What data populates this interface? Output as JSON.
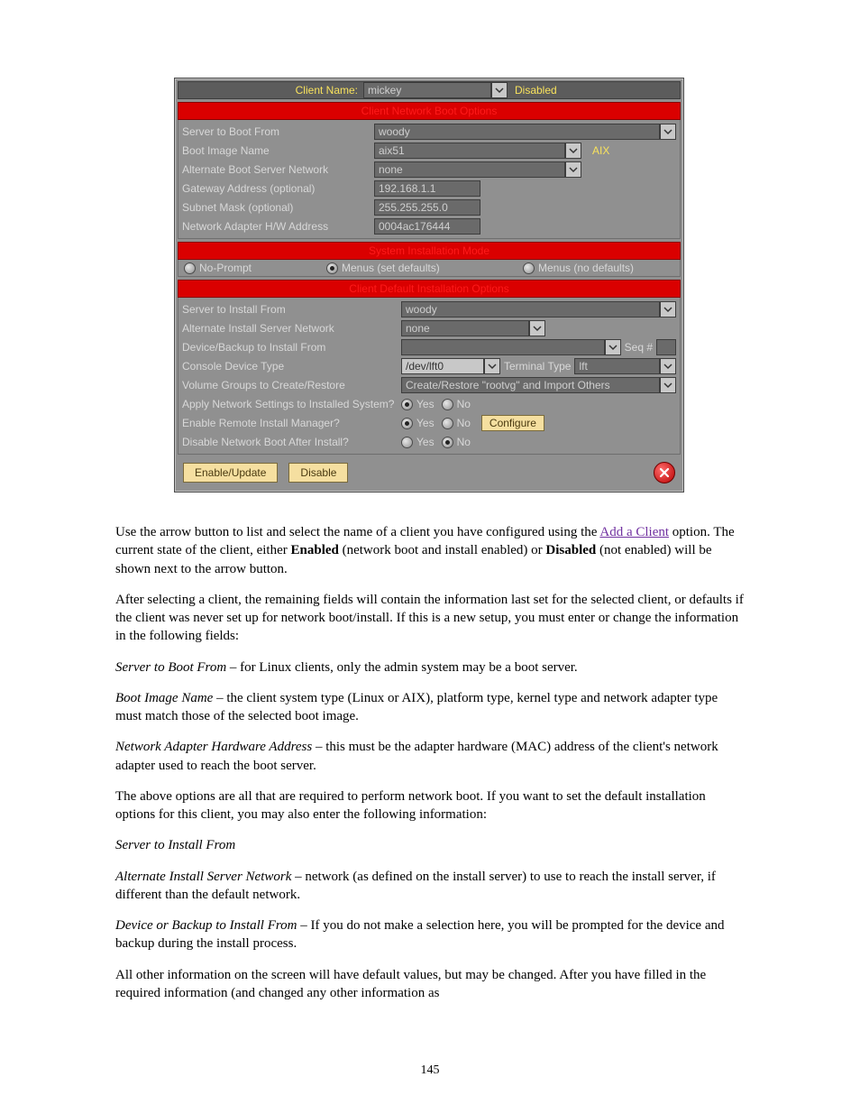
{
  "top": {
    "client_name_label": "Client Name:",
    "client_name_value": "mickey",
    "status": "Disabled"
  },
  "sections": {
    "boot": {
      "title": "Client Network Boot Options",
      "server_label": "Server to Boot From",
      "server_value": "woody",
      "image_label": "Boot Image Name",
      "image_value": "aix51",
      "image_tag": "AIX",
      "alt_net_label": "Alternate Boot Server Network",
      "alt_net_value": "none",
      "gateway_label": "Gateway Address (optional)",
      "gateway_value": "192.168.1.1",
      "subnet_label": "Subnet Mask (optional)",
      "subnet_value": "255.255.255.0",
      "hw_label": "Network Adapter H/W Address",
      "hw_value": "0004ac176444"
    },
    "mode": {
      "title": "System Installation Mode",
      "opt1": "No-Prompt",
      "opt2": "Menus (set defaults)",
      "opt3": "Menus (no defaults)",
      "selected": "opt2"
    },
    "install": {
      "title": "Client Default Installation Options",
      "server_label": "Server to Install From",
      "server_value": "woody",
      "alt_net_label": "Alternate Install Server Network",
      "alt_net_value": "none",
      "device_label": "Device/Backup to Install From",
      "device_value": "",
      "seq_label": "Seq #",
      "seq_value": "",
      "console_label": "Console Device Type",
      "console_value": "/dev/lft0",
      "termtype_label": "Terminal Type",
      "termtype_value": "lft",
      "vg_label": "Volume Groups to Create/Restore",
      "vg_value": "Create/Restore \"rootvg\" and Import Others",
      "apply_net_label": "Apply Network Settings to Installed System?",
      "apply_net_yes": "Yes",
      "apply_net_no": "No",
      "apply_net_selected": "yes",
      "rim_label": "Enable Remote Install Manager?",
      "rim_yes": "Yes",
      "rim_no": "No",
      "rim_selected": "yes",
      "rim_configure": "Configure",
      "disable_boot_label": "Disable Network Boot After Install?",
      "disable_boot_yes": "Yes",
      "disable_boot_no": "No",
      "disable_boot_selected": "no"
    }
  },
  "footer": {
    "enable": "Enable/Update",
    "disable": "Disable"
  },
  "doc": {
    "p1a": "Use the arrow button to list and select the name of a client you have configured using the ",
    "p1_link": "Add a Client",
    "p1b": " option. The current state of the client, either ",
    "p1_enabled": "Enabled",
    "p1c": " (network boot and install enabled) or ",
    "p1_disabled": "Disabled",
    "p1d": " (not enabled) will be shown next to the arrow button.",
    "p2": "After selecting a client, the remaining fields will contain the information last set for the selected client, or defaults if the client was never set up for network boot/install. If this is a new setup, you must enter or change the information in the following fields:",
    "f_server_boot": "Server to Boot From",
    "f_server_boot_desc": " – for Linux clients, only the admin system may be a boot server.",
    "f_boot_image": "Boot Image Name",
    "f_boot_image_desc": " – the client system type (Linux or AIX), platform type, kernel type and network adapter type must match those of the selected boot image.",
    "f_hw": "Network Adapter Hardware Address",
    "f_hw_desc": " – this must be the adapter hardware (MAC) address of the client's network adapter used to reach the boot server.",
    "p3": "The above options are all that are required to perform network boot. If you want to set the default installation options for this client, you may also enter the following information:",
    "f_server_install": "Server to Install From",
    "f_alt_net": "Alternate Install Server Network",
    "f_alt_net_desc": " – network (as defined on the install server) to use to reach the install server, if different than the default network.",
    "f_device": "Device or Backup to Install From",
    "f_device_desc": " – If you do not make a selection here, you will be prompted for the device and backup during the install process.",
    "p4": "All other information on the screen will have default values, but may be changed. After you have filled in the required information (and changed any other information as"
  },
  "page_number": "145"
}
